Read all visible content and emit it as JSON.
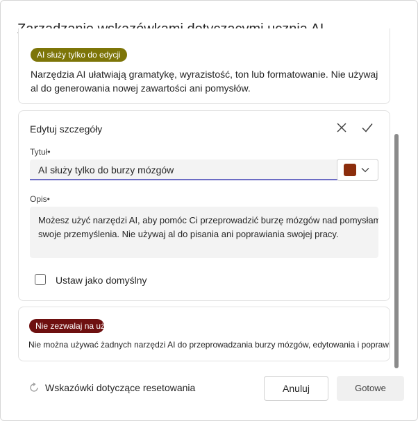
{
  "dialog": {
    "title": "Zarządzanie wskazówkami dotyczącymi ucznia AI"
  },
  "guidance_top": {
    "badge": "AI służy tylko do edycji",
    "badge_color": "#7d7508",
    "description": "Narzędzia AI ułatwiają gramatykę, wyrazistość, ton lub formatowanie. Nie używaj al do generowania nowej zawartości ani pomysłów."
  },
  "edit_card": {
    "heading": "Edytuj szczegóły",
    "close_icon": "close-icon",
    "confirm_icon": "checkmark-icon",
    "title_label": "Tytuł•",
    "title_value": "AI służy tylko do burzy mózgów",
    "color_value": "#8b2d0c",
    "description_label": "Opis•",
    "description_lines": [
      "Możesz użyć narzędzi AI, aby pomóc Ci przeprowadzić burzę mózgów nad pomysłami i przedstawić",
      "swoje przemyślenia. Nie używaj al do pisania ani poprawiania swojej pracy."
    ],
    "default_checkbox_label": "Ustaw jako domyślny",
    "default_checked": false
  },
  "guidance_bottom": {
    "badge": "Nie zezwalaj na używ",
    "badge_color": "#6e1010",
    "description": "Nie można używać żadnych narzędzi AI do przeprowadzania burzy mózgów, edytowania i poprawiania pracy."
  },
  "footer": {
    "reset_label": "Wskazówki dotyczące resetowania",
    "reset_icon": "refresh-icon",
    "cancel_label": "Anuluj",
    "done_label": "Gotowe"
  }
}
